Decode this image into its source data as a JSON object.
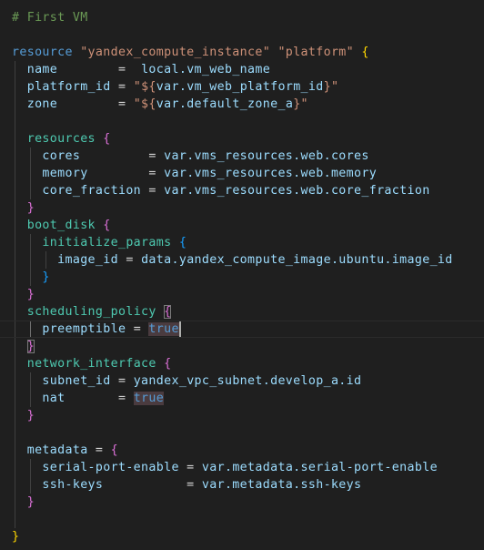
{
  "editor": {
    "lines": [
      [
        {
          "t": "# First VM",
          "c": "comment"
        }
      ],
      [],
      [
        {
          "t": "resource",
          "c": "keyword"
        },
        {
          "t": " ",
          "c": "op"
        },
        {
          "t": "\"yandex_compute_instance\"",
          "c": "string"
        },
        {
          "t": " ",
          "c": "op"
        },
        {
          "t": "\"platform\"",
          "c": "string"
        },
        {
          "t": " ",
          "c": "op"
        },
        {
          "t": "{",
          "c": "b1"
        }
      ],
      [
        {
          "t": "  ",
          "c": "op"
        },
        {
          "t": "name",
          "c": "attr"
        },
        {
          "t": "        =  ",
          "c": "op"
        },
        {
          "t": "local.vm_web_name",
          "c": "ident"
        }
      ],
      [
        {
          "t": "  ",
          "c": "op"
        },
        {
          "t": "platform_id",
          "c": "attr"
        },
        {
          "t": " = ",
          "c": "op"
        },
        {
          "t": "\"${",
          "c": "string"
        },
        {
          "t": "var.vm_web_platform_id",
          "c": "ident"
        },
        {
          "t": "}\"",
          "c": "string"
        }
      ],
      [
        {
          "t": "  ",
          "c": "op"
        },
        {
          "t": "zone",
          "c": "attr"
        },
        {
          "t": "        = ",
          "c": "op"
        },
        {
          "t": "\"${",
          "c": "string"
        },
        {
          "t": "var.default_zone_a",
          "c": "ident"
        },
        {
          "t": "}\"",
          "c": "string"
        }
      ],
      [],
      [
        {
          "t": "  ",
          "c": "op"
        },
        {
          "t": "resources",
          "c": "block"
        },
        {
          "t": " ",
          "c": "op"
        },
        {
          "t": "{",
          "c": "b2"
        }
      ],
      [
        {
          "t": "    ",
          "c": "op"
        },
        {
          "t": "cores",
          "c": "attr"
        },
        {
          "t": "         = ",
          "c": "op"
        },
        {
          "t": "var.vms_resources.web.cores",
          "c": "ident"
        }
      ],
      [
        {
          "t": "    ",
          "c": "op"
        },
        {
          "t": "memory",
          "c": "attr"
        },
        {
          "t": "        = ",
          "c": "op"
        },
        {
          "t": "var.vms_resources.web.memory",
          "c": "ident"
        }
      ],
      [
        {
          "t": "    ",
          "c": "op"
        },
        {
          "t": "core_fraction",
          "c": "attr"
        },
        {
          "t": " = ",
          "c": "op"
        },
        {
          "t": "var.vms_resources.web.core_fraction",
          "c": "ident"
        }
      ],
      [
        {
          "t": "  ",
          "c": "op"
        },
        {
          "t": "}",
          "c": "b2"
        }
      ],
      [
        {
          "t": "  ",
          "c": "op"
        },
        {
          "t": "boot_disk",
          "c": "block"
        },
        {
          "t": " ",
          "c": "op"
        },
        {
          "t": "{",
          "c": "b2"
        }
      ],
      [
        {
          "t": "    ",
          "c": "op"
        },
        {
          "t": "initialize_params",
          "c": "block"
        },
        {
          "t": " ",
          "c": "op"
        },
        {
          "t": "{",
          "c": "b3"
        }
      ],
      [
        {
          "t": "      ",
          "c": "op"
        },
        {
          "t": "image_id",
          "c": "attr"
        },
        {
          "t": " = ",
          "c": "op"
        },
        {
          "t": "data.yandex_compute_image.ubuntu.image_id",
          "c": "ident"
        }
      ],
      [
        {
          "t": "    ",
          "c": "op"
        },
        {
          "t": "}",
          "c": "b3"
        }
      ],
      [
        {
          "t": "  ",
          "c": "op"
        },
        {
          "t": "}",
          "c": "b2"
        }
      ],
      [
        {
          "t": "  ",
          "c": "op"
        },
        {
          "t": "scheduling_policy",
          "c": "block"
        },
        {
          "t": " ",
          "c": "op"
        },
        {
          "t": "{",
          "c": "b2",
          "m": true
        }
      ],
      [
        {
          "t": "    ",
          "c": "op"
        },
        {
          "t": "preemptible",
          "c": "attr"
        },
        {
          "t": " = ",
          "c": "op"
        },
        {
          "t": "true",
          "c": "bool",
          "h": true
        }
      ],
      [
        {
          "t": "  ",
          "c": "op"
        },
        {
          "t": "}",
          "c": "b2",
          "m": true
        }
      ],
      [
        {
          "t": "  ",
          "c": "op"
        },
        {
          "t": "network_interface",
          "c": "block"
        },
        {
          "t": " ",
          "c": "op"
        },
        {
          "t": "{",
          "c": "b2"
        }
      ],
      [
        {
          "t": "    ",
          "c": "op"
        },
        {
          "t": "subnet_id",
          "c": "attr"
        },
        {
          "t": " = ",
          "c": "op"
        },
        {
          "t": "yandex_vpc_subnet.develop_a.id",
          "c": "ident"
        }
      ],
      [
        {
          "t": "    ",
          "c": "op"
        },
        {
          "t": "nat",
          "c": "attr"
        },
        {
          "t": "       = ",
          "c": "op"
        },
        {
          "t": "true",
          "c": "bool",
          "h": true
        }
      ],
      [
        {
          "t": "  ",
          "c": "op"
        },
        {
          "t": "}",
          "c": "b2"
        }
      ],
      [],
      [
        {
          "t": "  ",
          "c": "op"
        },
        {
          "t": "metadata",
          "c": "attr"
        },
        {
          "t": " = ",
          "c": "op"
        },
        {
          "t": "{",
          "c": "b2"
        }
      ],
      [
        {
          "t": "    ",
          "c": "op"
        },
        {
          "t": "serial-port-enable",
          "c": "attr"
        },
        {
          "t": " = ",
          "c": "op"
        },
        {
          "t": "var.metadata.serial-port-enable",
          "c": "ident"
        }
      ],
      [
        {
          "t": "    ",
          "c": "op"
        },
        {
          "t": "ssh-keys",
          "c": "attr"
        },
        {
          "t": "           = ",
          "c": "op"
        },
        {
          "t": "var.metadata.ssh-keys",
          "c": "ident"
        }
      ],
      [
        {
          "t": "  ",
          "c": "op"
        },
        {
          "t": "}",
          "c": "b2"
        }
      ],
      [],
      [
        {
          "t": "}",
          "c": "b1"
        }
      ]
    ],
    "colors": {
      "background": "#1f1f1f",
      "comment": "#6a9955",
      "keyword": "#569cd6",
      "string": "#ce9178",
      "attribute": "#9cdcfe",
      "block": "#4ec9b0",
      "bracket_level1": "#ffd700",
      "bracket_level2": "#da70d6",
      "bracket_level3": "#179fff"
    }
  }
}
